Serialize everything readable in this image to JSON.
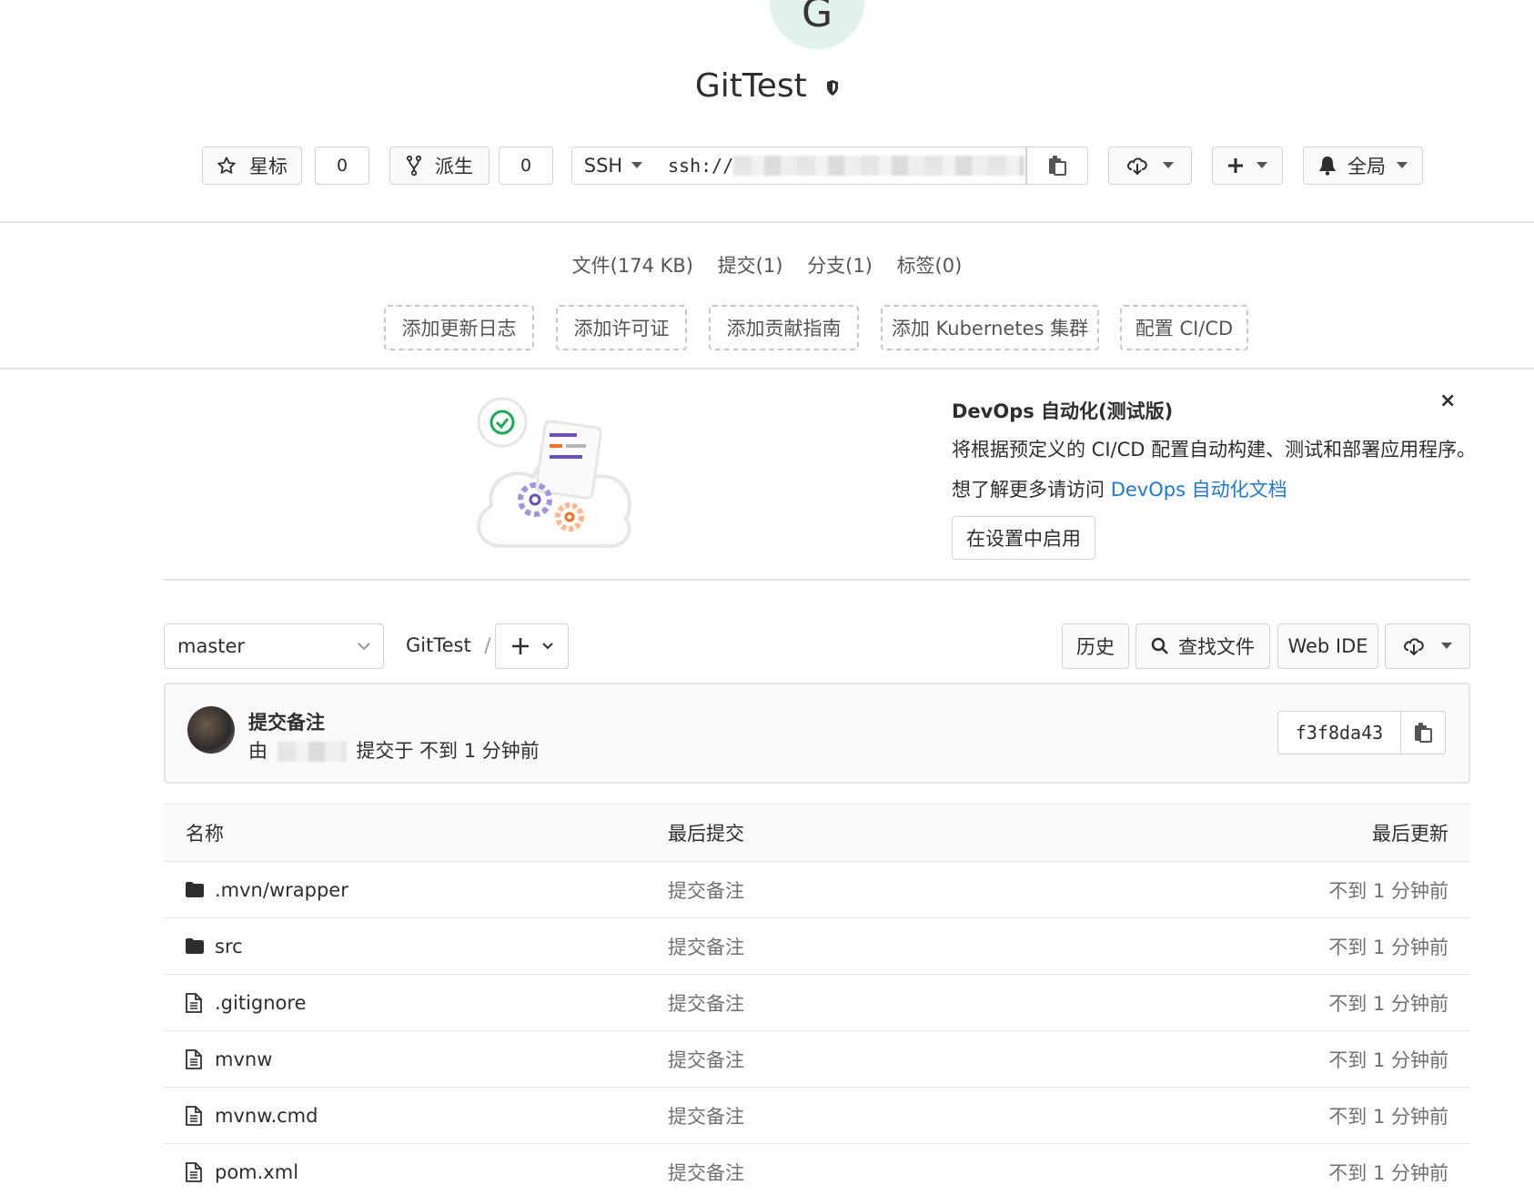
{
  "project": {
    "avatar_letter": "G",
    "name": "GitTest"
  },
  "actions": {
    "star_label": "星标",
    "star_count": "0",
    "fork_label": "派生",
    "fork_count": "0",
    "protocol": "SSH",
    "clone_url_prefix": "ssh://",
    "notification_label": "全局"
  },
  "stats": {
    "files": "文件(174 KB)",
    "commits": "提交(1)",
    "branches": "分支(1)",
    "tags": "标签(0)"
  },
  "quick_actions": [
    "添加更新日志",
    "添加许可证",
    "添加贡献指南",
    "添加 Kubernetes 集群",
    "配置 CI/CD"
  ],
  "devops": {
    "title": "DevOps 自动化(测试版)",
    "description": "将根据预定义的 CI/CD 配置自动构建、测试和部署应用程序。",
    "learn_more_prefix": "想了解更多请访问 ",
    "learn_more_link": "DevOps 自动化文档",
    "enable_button": "在设置中启用",
    "close": "×"
  },
  "repo_nav": {
    "branch": "master",
    "path_root": "GitTest",
    "path_sep": "/",
    "history": "历史",
    "find_file": "查找文件",
    "web_ide": "Web IDE"
  },
  "last_commit": {
    "message": "提交备注",
    "by_prefix": "由",
    "committed_text": "提交于 不到 1 分钟前",
    "sha": "f3f8da43"
  },
  "table": {
    "headers": {
      "name": "名称",
      "last_commit": "最后提交",
      "last_update": "最后更新"
    },
    "rows": [
      {
        "name": ".mvn/wrapper",
        "type": "folder",
        "commit": "提交备注",
        "time": "不到 1 分钟前"
      },
      {
        "name": "src",
        "type": "folder",
        "commit": "提交备注",
        "time": "不到 1 分钟前"
      },
      {
        "name": ".gitignore",
        "type": "file",
        "commit": "提交备注",
        "time": "不到 1 分钟前"
      },
      {
        "name": "mvnw",
        "type": "file",
        "commit": "提交备注",
        "time": "不到 1 分钟前"
      },
      {
        "name": "mvnw.cmd",
        "type": "file",
        "commit": "提交备注",
        "time": "不到 1 分钟前"
      },
      {
        "name": "pom.xml",
        "type": "file",
        "commit": "提交备注",
        "time": "不到 1 分钟前"
      }
    ]
  },
  "colors": {
    "link": "#1f78d1",
    "avatar_bg": "#e0f1ee",
    "border": "#e5e5e5"
  }
}
